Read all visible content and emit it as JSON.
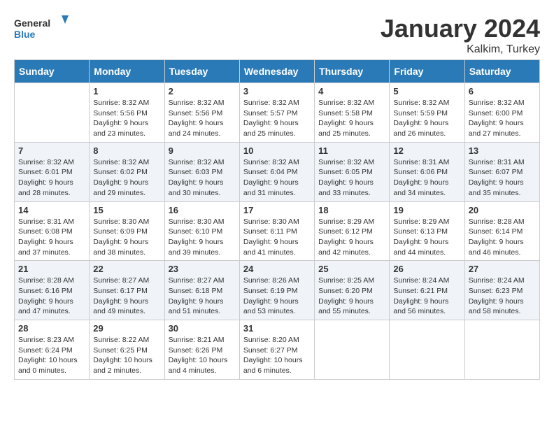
{
  "header": {
    "logo_general": "General",
    "logo_blue": "Blue",
    "month_title": "January 2024",
    "location": "Kalkim, Turkey"
  },
  "weekdays": [
    "Sunday",
    "Monday",
    "Tuesday",
    "Wednesday",
    "Thursday",
    "Friday",
    "Saturday"
  ],
  "weeks": [
    [
      {
        "day": "",
        "sunrise": "",
        "sunset": "",
        "daylight": ""
      },
      {
        "day": "1",
        "sunrise": "Sunrise: 8:32 AM",
        "sunset": "Sunset: 5:56 PM",
        "daylight": "Daylight: 9 hours and 23 minutes."
      },
      {
        "day": "2",
        "sunrise": "Sunrise: 8:32 AM",
        "sunset": "Sunset: 5:56 PM",
        "daylight": "Daylight: 9 hours and 24 minutes."
      },
      {
        "day": "3",
        "sunrise": "Sunrise: 8:32 AM",
        "sunset": "Sunset: 5:57 PM",
        "daylight": "Daylight: 9 hours and 25 minutes."
      },
      {
        "day": "4",
        "sunrise": "Sunrise: 8:32 AM",
        "sunset": "Sunset: 5:58 PM",
        "daylight": "Daylight: 9 hours and 25 minutes."
      },
      {
        "day": "5",
        "sunrise": "Sunrise: 8:32 AM",
        "sunset": "Sunset: 5:59 PM",
        "daylight": "Daylight: 9 hours and 26 minutes."
      },
      {
        "day": "6",
        "sunrise": "Sunrise: 8:32 AM",
        "sunset": "Sunset: 6:00 PM",
        "daylight": "Daylight: 9 hours and 27 minutes."
      }
    ],
    [
      {
        "day": "7",
        "sunrise": "Sunrise: 8:32 AM",
        "sunset": "Sunset: 6:01 PM",
        "daylight": "Daylight: 9 hours and 28 minutes."
      },
      {
        "day": "8",
        "sunrise": "Sunrise: 8:32 AM",
        "sunset": "Sunset: 6:02 PM",
        "daylight": "Daylight: 9 hours and 29 minutes."
      },
      {
        "day": "9",
        "sunrise": "Sunrise: 8:32 AM",
        "sunset": "Sunset: 6:03 PM",
        "daylight": "Daylight: 9 hours and 30 minutes."
      },
      {
        "day": "10",
        "sunrise": "Sunrise: 8:32 AM",
        "sunset": "Sunset: 6:04 PM",
        "daylight": "Daylight: 9 hours and 31 minutes."
      },
      {
        "day": "11",
        "sunrise": "Sunrise: 8:32 AM",
        "sunset": "Sunset: 6:05 PM",
        "daylight": "Daylight: 9 hours and 33 minutes."
      },
      {
        "day": "12",
        "sunrise": "Sunrise: 8:31 AM",
        "sunset": "Sunset: 6:06 PM",
        "daylight": "Daylight: 9 hours and 34 minutes."
      },
      {
        "day": "13",
        "sunrise": "Sunrise: 8:31 AM",
        "sunset": "Sunset: 6:07 PM",
        "daylight": "Daylight: 9 hours and 35 minutes."
      }
    ],
    [
      {
        "day": "14",
        "sunrise": "Sunrise: 8:31 AM",
        "sunset": "Sunset: 6:08 PM",
        "daylight": "Daylight: 9 hours and 37 minutes."
      },
      {
        "day": "15",
        "sunrise": "Sunrise: 8:30 AM",
        "sunset": "Sunset: 6:09 PM",
        "daylight": "Daylight: 9 hours and 38 minutes."
      },
      {
        "day": "16",
        "sunrise": "Sunrise: 8:30 AM",
        "sunset": "Sunset: 6:10 PM",
        "daylight": "Daylight: 9 hours and 39 minutes."
      },
      {
        "day": "17",
        "sunrise": "Sunrise: 8:30 AM",
        "sunset": "Sunset: 6:11 PM",
        "daylight": "Daylight: 9 hours and 41 minutes."
      },
      {
        "day": "18",
        "sunrise": "Sunrise: 8:29 AM",
        "sunset": "Sunset: 6:12 PM",
        "daylight": "Daylight: 9 hours and 42 minutes."
      },
      {
        "day": "19",
        "sunrise": "Sunrise: 8:29 AM",
        "sunset": "Sunset: 6:13 PM",
        "daylight": "Daylight: 9 hours and 44 minutes."
      },
      {
        "day": "20",
        "sunrise": "Sunrise: 8:28 AM",
        "sunset": "Sunset: 6:14 PM",
        "daylight": "Daylight: 9 hours and 46 minutes."
      }
    ],
    [
      {
        "day": "21",
        "sunrise": "Sunrise: 8:28 AM",
        "sunset": "Sunset: 6:16 PM",
        "daylight": "Daylight: 9 hours and 47 minutes."
      },
      {
        "day": "22",
        "sunrise": "Sunrise: 8:27 AM",
        "sunset": "Sunset: 6:17 PM",
        "daylight": "Daylight: 9 hours and 49 minutes."
      },
      {
        "day": "23",
        "sunrise": "Sunrise: 8:27 AM",
        "sunset": "Sunset: 6:18 PM",
        "daylight": "Daylight: 9 hours and 51 minutes."
      },
      {
        "day": "24",
        "sunrise": "Sunrise: 8:26 AM",
        "sunset": "Sunset: 6:19 PM",
        "daylight": "Daylight: 9 hours and 53 minutes."
      },
      {
        "day": "25",
        "sunrise": "Sunrise: 8:25 AM",
        "sunset": "Sunset: 6:20 PM",
        "daylight": "Daylight: 9 hours and 55 minutes."
      },
      {
        "day": "26",
        "sunrise": "Sunrise: 8:24 AM",
        "sunset": "Sunset: 6:21 PM",
        "daylight": "Daylight: 9 hours and 56 minutes."
      },
      {
        "day": "27",
        "sunrise": "Sunrise: 8:24 AM",
        "sunset": "Sunset: 6:23 PM",
        "daylight": "Daylight: 9 hours and 58 minutes."
      }
    ],
    [
      {
        "day": "28",
        "sunrise": "Sunrise: 8:23 AM",
        "sunset": "Sunset: 6:24 PM",
        "daylight": "Daylight: 10 hours and 0 minutes."
      },
      {
        "day": "29",
        "sunrise": "Sunrise: 8:22 AM",
        "sunset": "Sunset: 6:25 PM",
        "daylight": "Daylight: 10 hours and 2 minutes."
      },
      {
        "day": "30",
        "sunrise": "Sunrise: 8:21 AM",
        "sunset": "Sunset: 6:26 PM",
        "daylight": "Daylight: 10 hours and 4 minutes."
      },
      {
        "day": "31",
        "sunrise": "Sunrise: 8:20 AM",
        "sunset": "Sunset: 6:27 PM",
        "daylight": "Daylight: 10 hours and 6 minutes."
      },
      {
        "day": "",
        "sunrise": "",
        "sunset": "",
        "daylight": ""
      },
      {
        "day": "",
        "sunrise": "",
        "sunset": "",
        "daylight": ""
      },
      {
        "day": "",
        "sunrise": "",
        "sunset": "",
        "daylight": ""
      }
    ]
  ]
}
